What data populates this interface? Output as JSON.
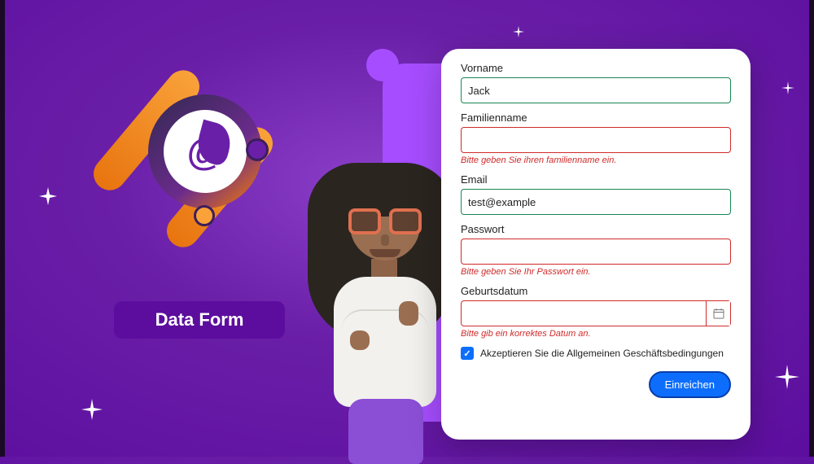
{
  "banner": {
    "title": "Data Form"
  },
  "icons": {
    "at": "@"
  },
  "form": {
    "firstname": {
      "label": "Vorname",
      "value": "Jack"
    },
    "lastname": {
      "label": "Familienname",
      "value": "",
      "error": "Bitte geben Sie ihren familienname ein."
    },
    "email": {
      "label": "Email",
      "value": "test@example"
    },
    "password": {
      "label": "Passwort",
      "value": "",
      "error": "Bitte geben Sie Ihr Passwort ein."
    },
    "dob": {
      "label": "Geburtsdatum",
      "value": "",
      "error": "Bitte gib ein korrektes Datum an."
    },
    "terms": {
      "label": "Akzeptieren Sie die Allgemeinen Geschäftsbedingungen",
      "checked": true
    },
    "submit": {
      "label": "Einreichen"
    }
  }
}
